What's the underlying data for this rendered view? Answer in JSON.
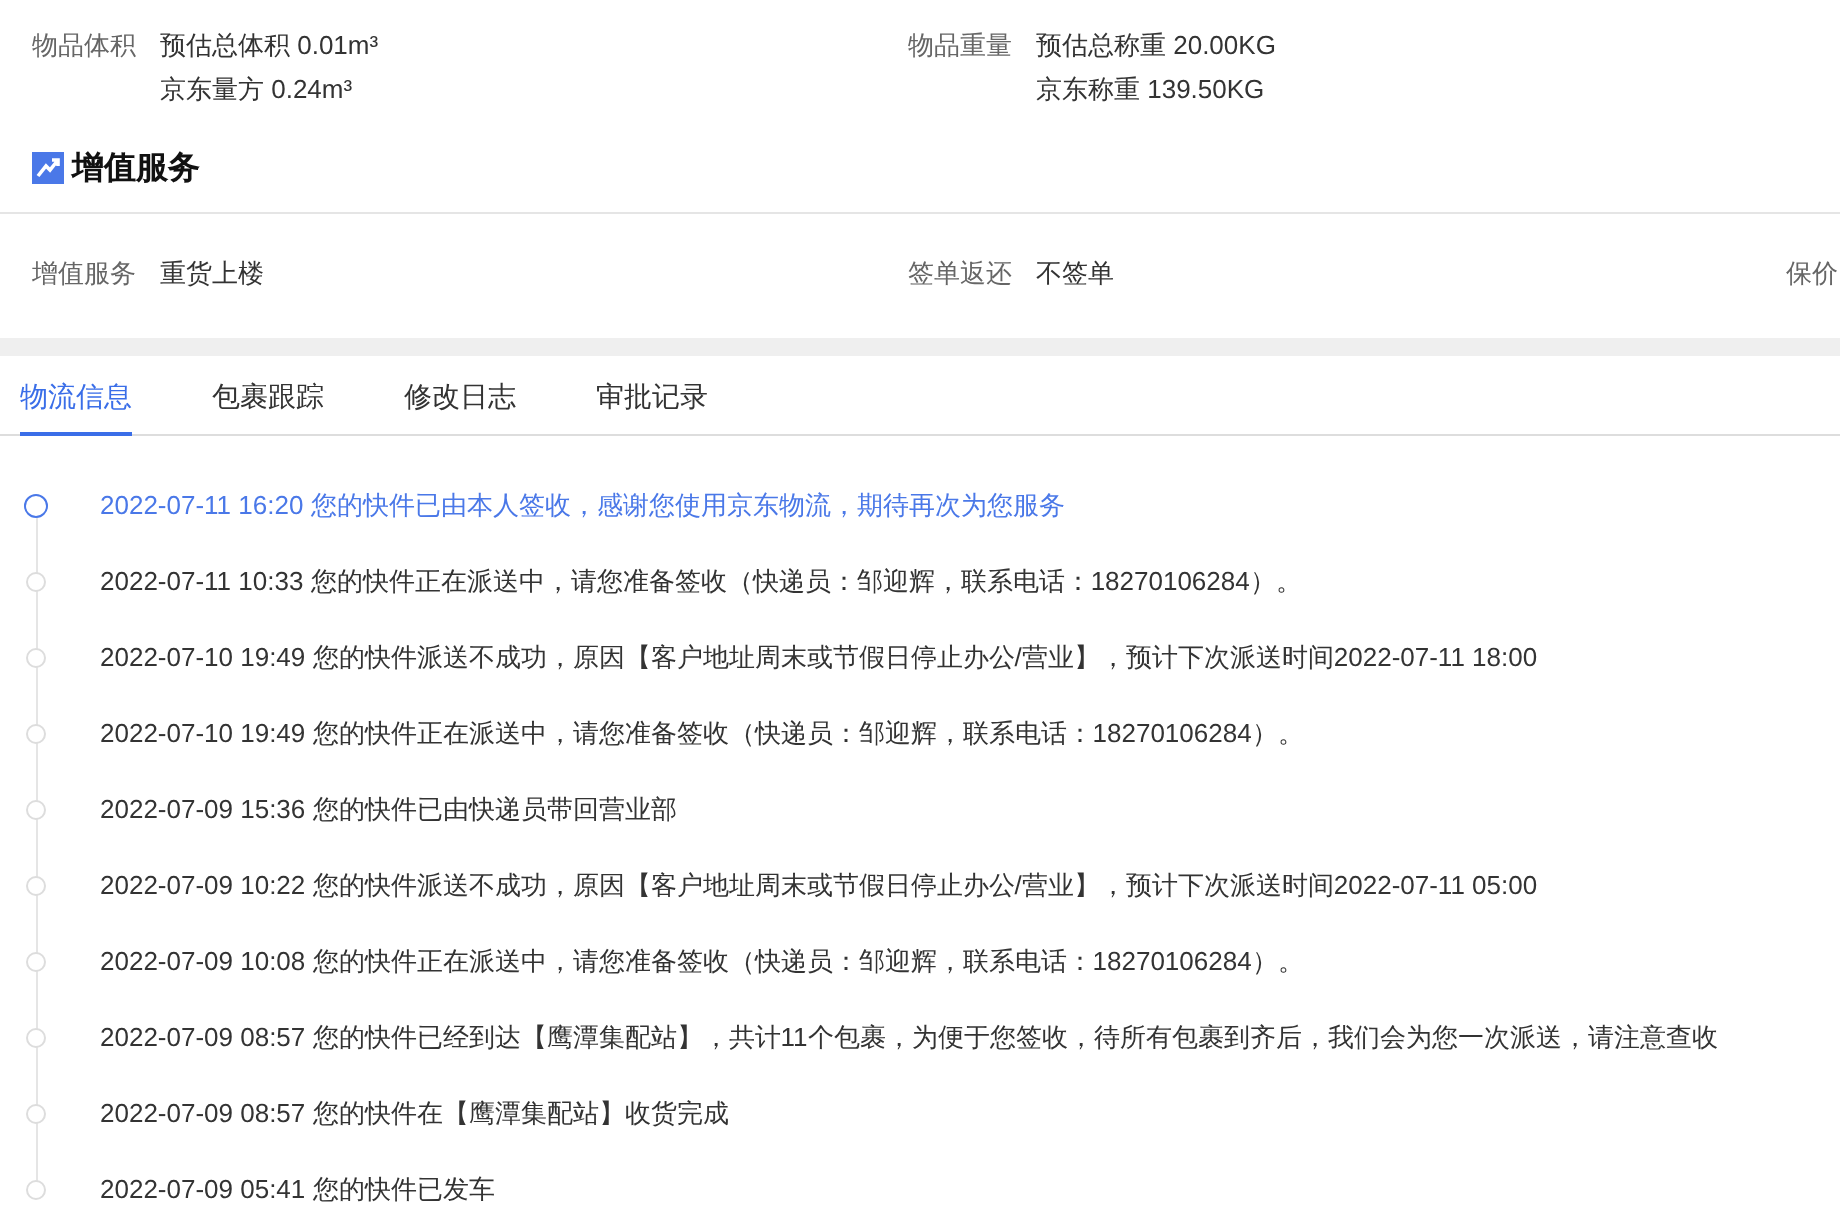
{
  "info_fields": [
    {
      "label": "物品体积",
      "values": [
        "预估总体积 0.01m³",
        "京东量方 0.24m³"
      ]
    },
    {
      "label": "物品重量",
      "values": [
        "预估总称重 20.00KG",
        "京东称重 139.50KG"
      ]
    }
  ],
  "section": {
    "title": "增值服务"
  },
  "service_fields": [
    {
      "label": "增值服务",
      "value": "重货上楼"
    },
    {
      "label": "签单返还",
      "value": "不签单"
    },
    {
      "label": "保价"
    }
  ],
  "tabs": [
    {
      "label": "物流信息",
      "selected": true
    },
    {
      "label": "包裹跟踪",
      "selected": false
    },
    {
      "label": "修改日志",
      "selected": false
    },
    {
      "label": "审批记录",
      "selected": false
    }
  ],
  "timeline": [
    {
      "time": "2022-07-11 16:20",
      "text": "您的快件已由本人签收，感谢您使用京东物流，期待再次为您服务",
      "current": true
    },
    {
      "time": "2022-07-11 10:33",
      "text": "您的快件正在派送中，请您准备签收（快递员：邹迎辉，联系电话：18270106284）。",
      "current": false
    },
    {
      "time": "2022-07-10 19:49",
      "text": "您的快件派送不成功，原因【客户地址周末或节假日停止办公/营业】，预计下次派送时间2022-07-11 18:00",
      "current": false
    },
    {
      "time": "2022-07-10 19:49",
      "text": "您的快件正在派送中，请您准备签收（快递员：邹迎辉，联系电话：18270106284）。",
      "current": false
    },
    {
      "time": "2022-07-09 15:36",
      "text": "您的快件已由快递员带回营业部",
      "current": false
    },
    {
      "time": "2022-07-09 10:22",
      "text": "您的快件派送不成功，原因【客户地址周末或节假日停止办公/营业】，预计下次派送时间2022-07-11 05:00",
      "current": false
    },
    {
      "time": "2022-07-09 10:08",
      "text": "您的快件正在派送中，请您准备签收（快递员：邹迎辉，联系电话：18270106284）。",
      "current": false
    },
    {
      "time": "2022-07-09 08:57",
      "text": "您的快件已经到达【鹰潭集配站】，共计11个包裹，为便于您签收，待所有包裹到齐后，我们会为您一次派送，请注意查收",
      "current": false
    },
    {
      "time": "2022-07-09 08:57",
      "text": "您的快件在【鹰潭集配站】收货完成",
      "current": false
    },
    {
      "time": "2022-07-09 05:41",
      "text": "您的快件已发车",
      "current": false
    }
  ]
}
